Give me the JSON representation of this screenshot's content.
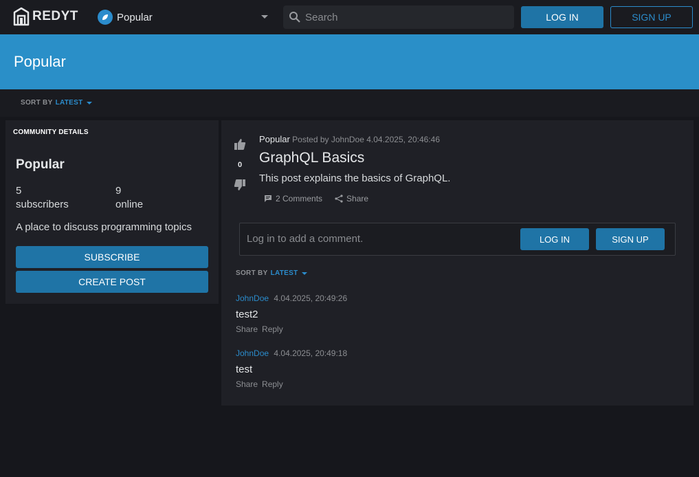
{
  "header": {
    "logo_text": "REDYT",
    "community_select": "Popular",
    "search_placeholder": "Search",
    "login_label": "LOG IN",
    "signup_label": "SIGN UP"
  },
  "banner": {
    "title": "Popular"
  },
  "sort": {
    "label": "SORT BY",
    "value": "LATEST"
  },
  "sidebar": {
    "heading": "COMMUNITY DETAILS",
    "name": "Popular",
    "subscribers_count": "5",
    "subscribers_label": "subscribers",
    "online_count": "9",
    "online_label": "online",
    "description": "A place to discuss programming topics",
    "subscribe_label": "SUBSCRIBE",
    "create_post_label": "CREATE POST"
  },
  "post": {
    "vote_count": "0",
    "community": "Popular",
    "posted_by": "Posted by JohnDoe 4.04.2025, 20:46:46",
    "title": "GraphQL Basics",
    "body": "This post explains the basics of GraphQL.",
    "comments_label": "2 Comments",
    "share_label": "Share"
  },
  "comment_box": {
    "placeholder": "Log in to add a comment.",
    "login_label": "LOG IN",
    "signup_label": "SIGN UP"
  },
  "comment_sort": {
    "label": "SORT BY",
    "value": "LATEST"
  },
  "comments": [
    {
      "author": "JohnDoe",
      "time": "4.04.2025, 20:49:26",
      "text": "test2",
      "share": "Share",
      "reply": "Reply"
    },
    {
      "author": "JohnDoe",
      "time": "4.04.2025, 20:49:18",
      "text": "test",
      "share": "Share",
      "reply": "Reply"
    }
  ],
  "colors": {
    "accent": "#2a8fc8",
    "button": "#1f74a6",
    "background": "#16171c",
    "panel": "#1f2026"
  }
}
